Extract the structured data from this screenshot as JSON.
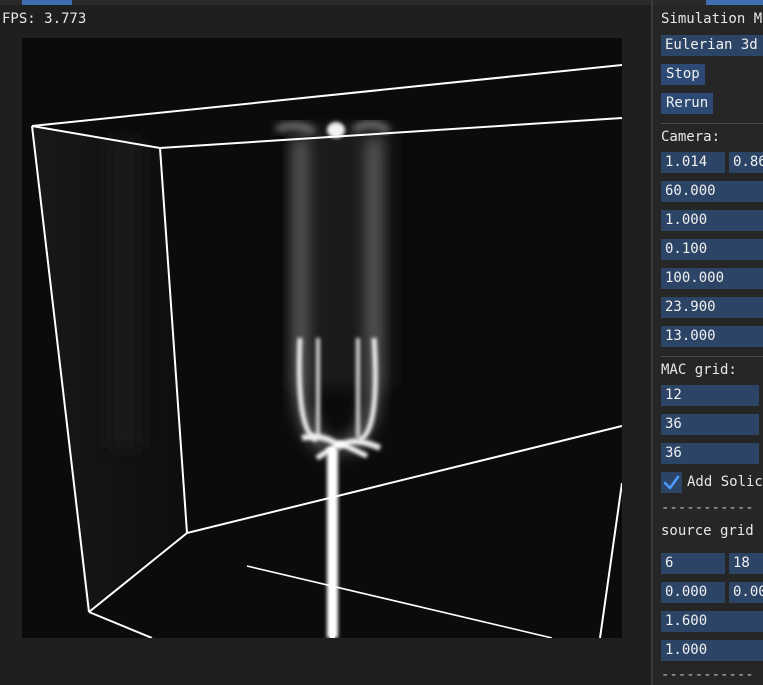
{
  "viewport": {
    "fps_text": "FPS: 3.773"
  },
  "panel": {
    "title": "Simulation M",
    "mode_value": "Eulerian 3d",
    "stop_label": "Stop",
    "rerun_label": "Rerun",
    "camera_label": "Camera:",
    "camera_pos_x": "1.014",
    "camera_pos_y": "0.86",
    "camera_fields": [
      "60.000",
      "1.000",
      "0.100",
      "100.000",
      "23.900",
      "13.000"
    ],
    "mac_label": "MAC grid:",
    "mac_fields": [
      "12",
      "36",
      "36"
    ],
    "add_solid_label": "Add Solic",
    "add_solid_checked": true,
    "dashes": "-----------",
    "source_label": "source grid",
    "source_a": "6",
    "source_b": "18",
    "source_c": "0.000",
    "source_d": "0.00",
    "source_fields": [
      "1.600",
      "1.000"
    ]
  },
  "colors": {
    "field_bg": "#2c4466",
    "button_bg": "#2c4a73",
    "check_mark": "#4a9aff",
    "accent_tab": "#3f6fb0"
  }
}
